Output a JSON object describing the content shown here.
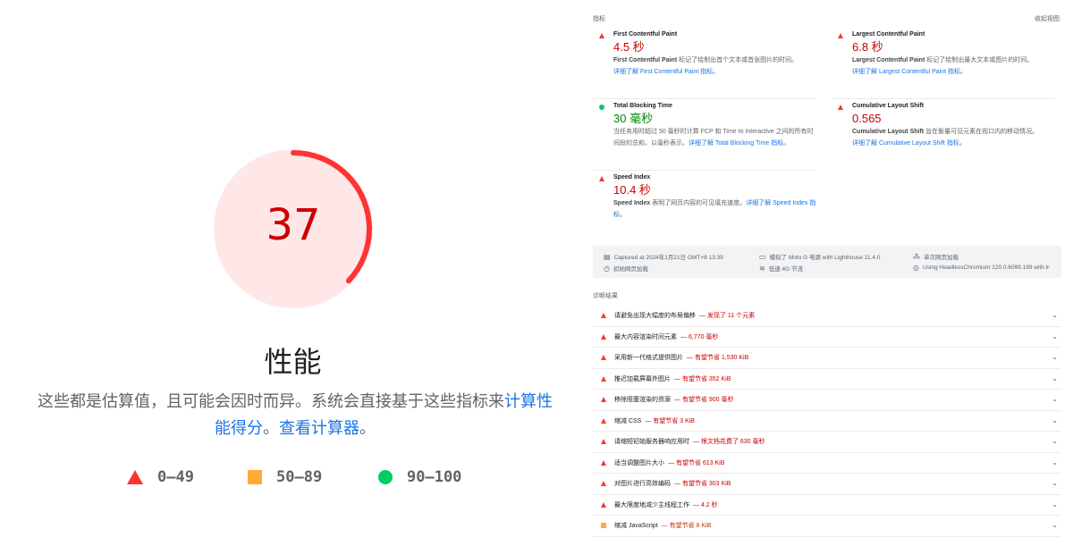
{
  "score": {
    "value": "37",
    "fraction": 0.37,
    "color": "#ff3333",
    "bg_color": "#ffe7e7"
  },
  "category": {
    "title": "性能",
    "desc_main": "这些都是估算值，且可能会因时而异。系统会直接基于这些指标来",
    "desc_link1": "计算性能得分",
    "desc_mid": "。",
    "desc_link2": "查看计算器",
    "desc_end": "。"
  },
  "legend": [
    {
      "range": "0–49",
      "shape": "triangle",
      "color": "#ff3333"
    },
    {
      "range": "50–89",
      "shape": "square",
      "color": "#ffaa33"
    },
    {
      "range": "90–100",
      "shape": "circle",
      "color": "#00cc66"
    }
  ],
  "metrics_header": {
    "title": "指标",
    "toggle": "收起视图"
  },
  "metrics": [
    {
      "title": "First Contentful Paint",
      "value": "4.5 秒",
      "rating": "fail",
      "desc_name": "First Contentful Paint",
      "desc_text": " 标记了绘制出首个文本或首张图片的时间。",
      "link": "详细了解 First Contentful Paint 指标"
    },
    {
      "title": "Largest Contentful Paint",
      "value": "6.8 秒",
      "rating": "fail",
      "desc_name": "Largest Contentful Paint",
      "desc_text": " 标记了绘制出最大文本或图片的时间。",
      "link": "详细了解 Largest Contentful Paint 指标"
    },
    {
      "title": "Total Blocking Time",
      "value": "30 毫秒",
      "rating": "pass",
      "desc_text": "当任务用时超过 50 毫秒时计算 FCP 和 Time to Interactive 之间的所有时间段的总和，以毫秒表示。",
      "link": "详细了解 Total Blocking Time 指标"
    },
    {
      "title": "Cumulative Layout Shift",
      "value": "0.565",
      "rating": "fail",
      "desc_name": "Cumulative Layout Shift",
      "desc_text": " 旨在衡量可见元素在视口内的移动情况。",
      "link": "详细了解 Cumulative Layout Shift 指标"
    },
    {
      "title": "Speed Index",
      "value": "10.4 秒",
      "rating": "fail",
      "desc_name": "Speed Index",
      "desc_text": " 表明了网页内容的可见填充速度。",
      "link": "详细了解 Speed Index 指标"
    }
  ],
  "runtime": {
    "captured": "Captured at 2024年1月21日 GMT+8 13:39",
    "device": "模拟了 Moto G 电源 with Lighthouse 11.4.0",
    "session": "单次网页加载",
    "initial": "初始网页加载",
    "throttle": "低速 4G 节流",
    "browser": "Using HeadlessChromium 120.0.6099.199 with lr"
  },
  "diagnostics": {
    "title": "诊断结果",
    "items": [
      {
        "title": "请避免出现大幅度的布局偏移",
        "display": "— 发现了 11 个元素",
        "rating": "fail"
      },
      {
        "title": "最大内容渲染时间元素",
        "display": "— 6,770 毫秒",
        "rating": "fail"
      },
      {
        "title": "采用新一代格式提供图片",
        "display": "— 有望节省 1,530 KiB",
        "rating": "fail"
      },
      {
        "title": "推迟加载屏幕外图片",
        "display": "— 有望节省 352 KiB",
        "rating": "fail"
      },
      {
        "title": "移除阻塞渲染的资源",
        "display": "— 有望节省 900 毫秒",
        "rating": "fail"
      },
      {
        "title": "缩减 CSS",
        "display": "— 有望节省 3 KiB",
        "rating": "fail"
      },
      {
        "title": "请缩短初始服务器响应用时",
        "display": "— 根文档花费了 630 毫秒",
        "rating": "fail"
      },
      {
        "title": "适当调整图片大小",
        "display": "— 有望节省 613 KiB",
        "rating": "fail"
      },
      {
        "title": "对图片进行高效编码",
        "display": "— 有望节省 303 KiB",
        "rating": "fail"
      },
      {
        "title": "最大限度地减少主线程工作",
        "display": "— 4.2 秒",
        "rating": "fail"
      },
      {
        "title": "缩减 JavaScript",
        "display": "— 有望节省 8 KiB",
        "rating": "average"
      }
    ]
  }
}
